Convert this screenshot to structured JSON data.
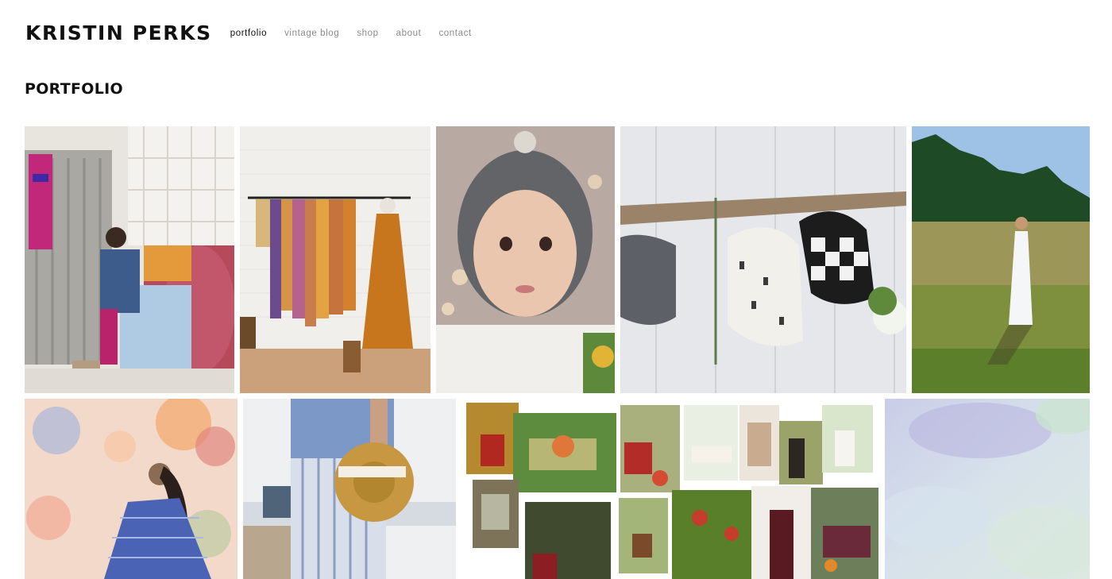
{
  "site": {
    "title": "KRISTIN PERKS"
  },
  "nav": {
    "items": [
      {
        "label": "portfolio",
        "active": true
      },
      {
        "label": "vintage blog",
        "active": false
      },
      {
        "label": "shop",
        "active": false
      },
      {
        "label": "about",
        "active": false
      },
      {
        "label": "contact",
        "active": false
      }
    ]
  },
  "page": {
    "title": "PORTFOLIO"
  },
  "gallery": {
    "tiles": [
      {
        "subject": "woman seated in floral armchair"
      },
      {
        "subject": "clothing rack with vintage dresses"
      },
      {
        "subject": "toddler in grey bonnet"
      },
      {
        "subject": "bonnets hanging from driftwood"
      },
      {
        "subject": "woman in white dress in meadow"
      },
      {
        "subject": "watercolor illustration of woman in gingham dress"
      },
      {
        "subject": "figure in striped pants holding straw hat"
      },
      {
        "subject": "collage of vintage furniture and fashion photos"
      },
      {
        "subject": "lavender and mint watercolor wash"
      }
    ]
  },
  "colors": {
    "text": "#111111",
    "nav_inactive": "#8a8a8a",
    "background": "#ffffff"
  }
}
